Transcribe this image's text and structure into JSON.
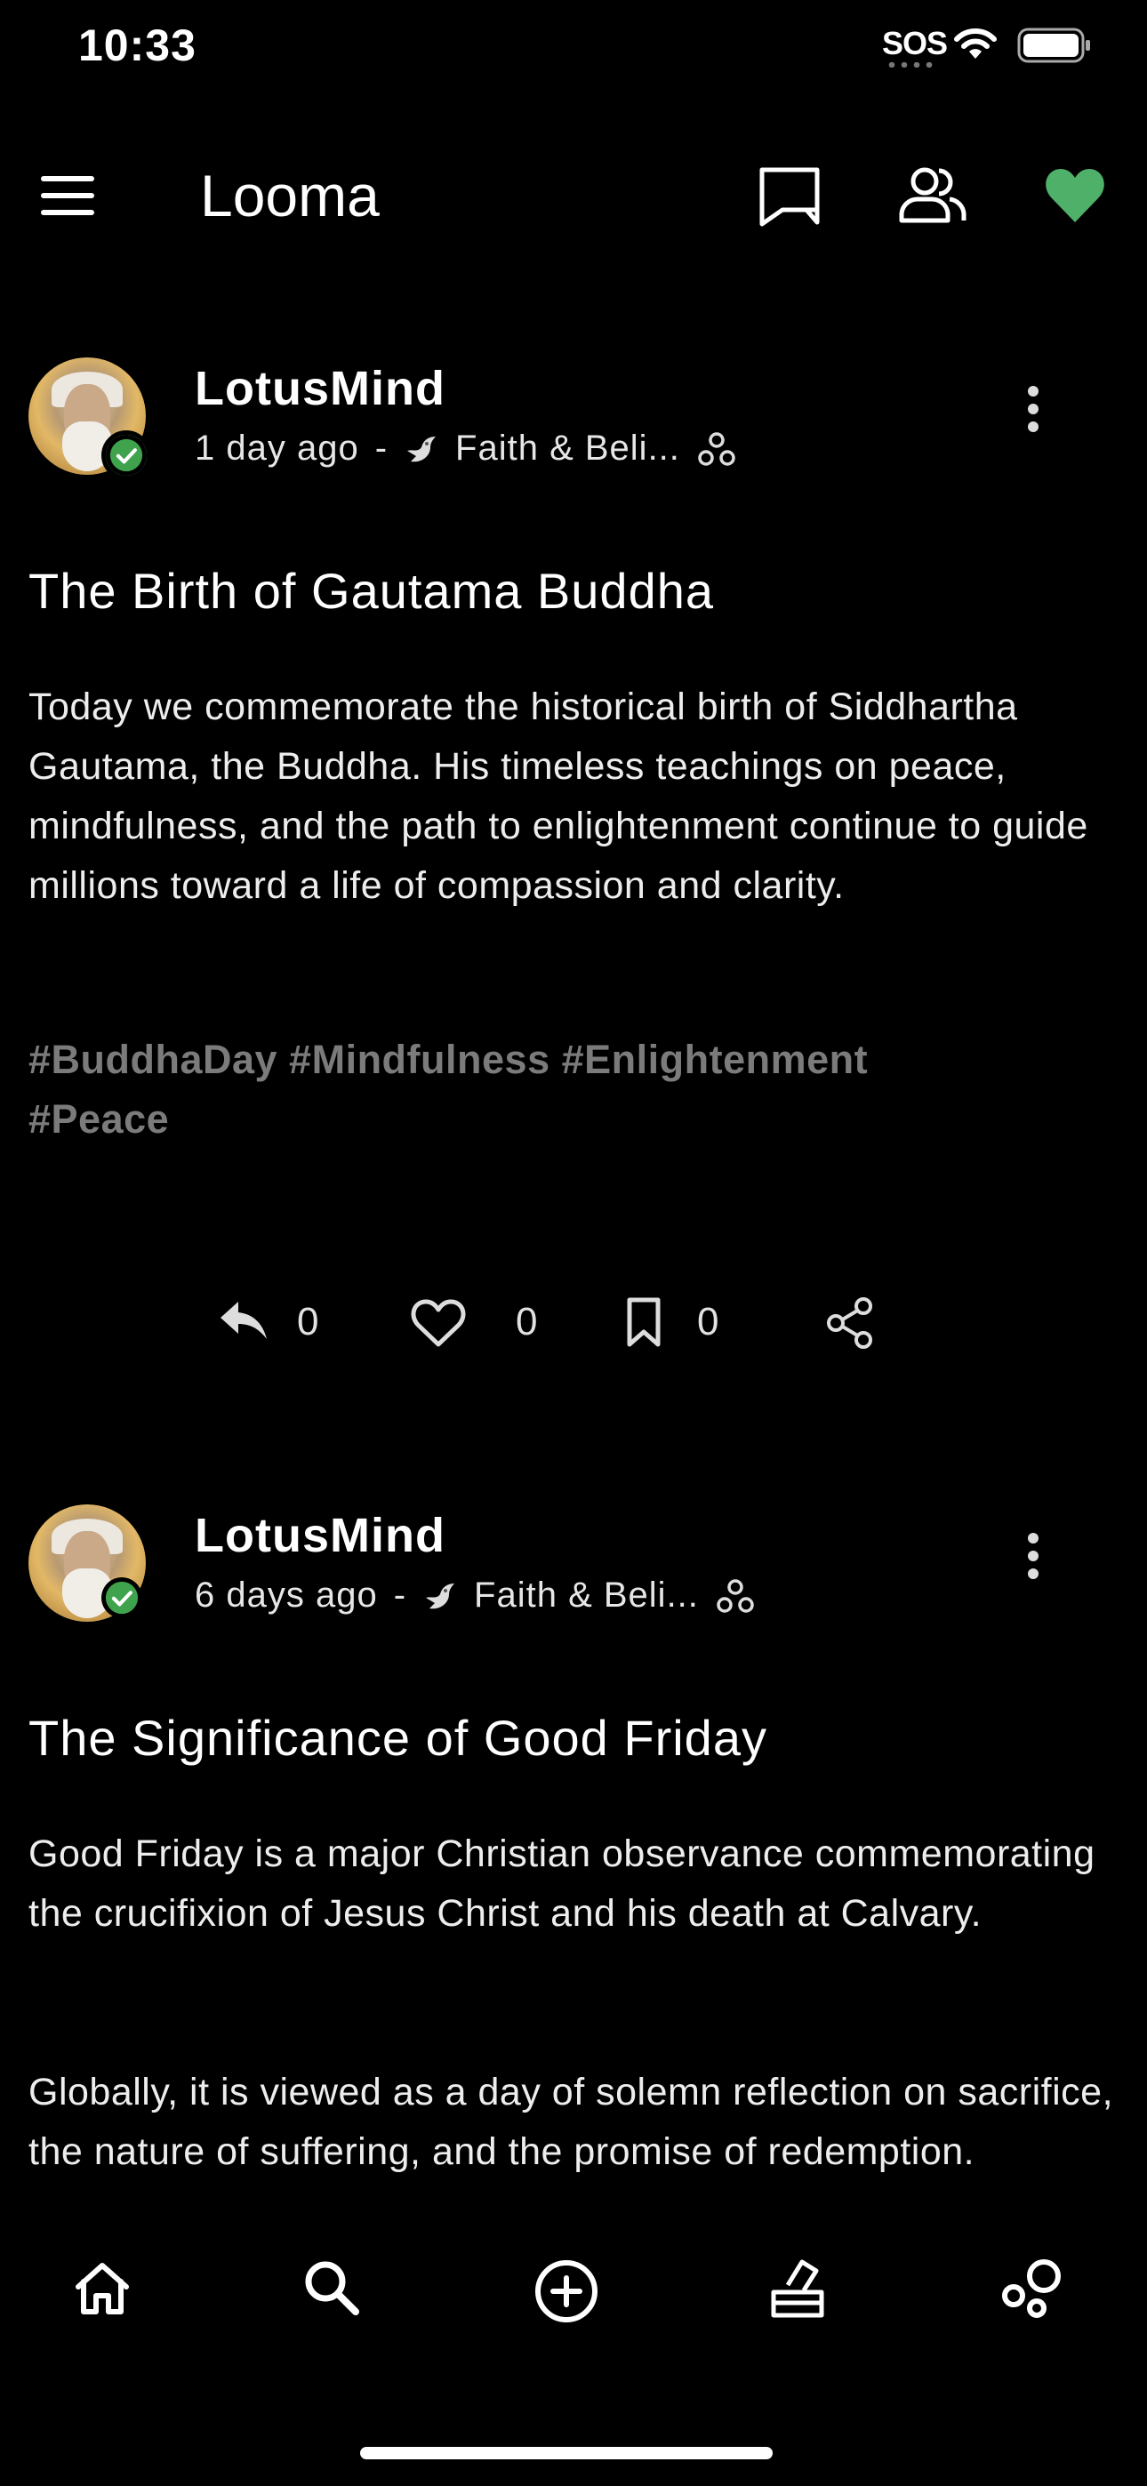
{
  "status_bar": {
    "time": "10:33",
    "sos": "SOS"
  },
  "header": {
    "title": "Looma"
  },
  "posts": [
    {
      "username": "LotusMind",
      "time": "1 day ago",
      "separator": "-",
      "community": "Faith & Beli...",
      "title": "The Birth of Gautama Buddha",
      "body": "Today we commemorate the historical birth of Siddhartha Gautama, the Buddha. His timeless teachings on peace, mindfulness, and the path to enlightenment continue to guide millions toward a life of compassion and clarity.",
      "hashtags": "#BuddhaDay #Mindfulness #Enlightenment #Peace",
      "replies": "0",
      "likes": "0",
      "bookmarks": "0"
    },
    {
      "username": "LotusMind",
      "time": "6 days ago",
      "separator": "-",
      "community": "Faith & Beli...",
      "title": "The Significance of Good Friday",
      "body_p1": "Good Friday is a major Christian observance commemorating the crucifixion of Jesus Christ and his death at Calvary.",
      "body_p2": "Globally, it is viewed as a day of solemn reflection on sacrifice, the nature of suffering, and the promise of redemption."
    }
  ],
  "colors": {
    "accent": "#4fb06a",
    "verified": "#3fa34d",
    "hashtag": "#7b7b7b"
  }
}
